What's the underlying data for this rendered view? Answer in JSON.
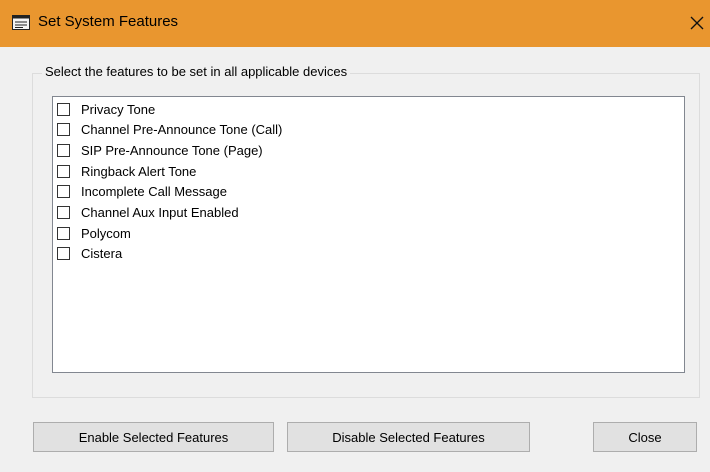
{
  "window": {
    "title": "Set System Features",
    "title_icon": "form-icon",
    "close_icon": "close-icon",
    "accent_color": "#e9962f"
  },
  "group": {
    "label": "Select the features to be set in all applicable devices"
  },
  "features": [
    {
      "label": "Privacy Tone",
      "checked": false
    },
    {
      "label": "Channel Pre-Announce Tone (Call)",
      "checked": false
    },
    {
      "label": "SIP Pre-Announce Tone (Page)",
      "checked": false
    },
    {
      "label": "Ringback Alert Tone",
      "checked": false
    },
    {
      "label": "Incomplete Call Message",
      "checked": false
    },
    {
      "label": "Channel Aux Input Enabled",
      "checked": false
    },
    {
      "label": "Polycom",
      "checked": false
    },
    {
      "label": "Cistera",
      "checked": false
    }
  ],
  "buttons": {
    "enable": "Enable Selected Features",
    "disable": "Disable Selected Features",
    "close": "Close"
  }
}
